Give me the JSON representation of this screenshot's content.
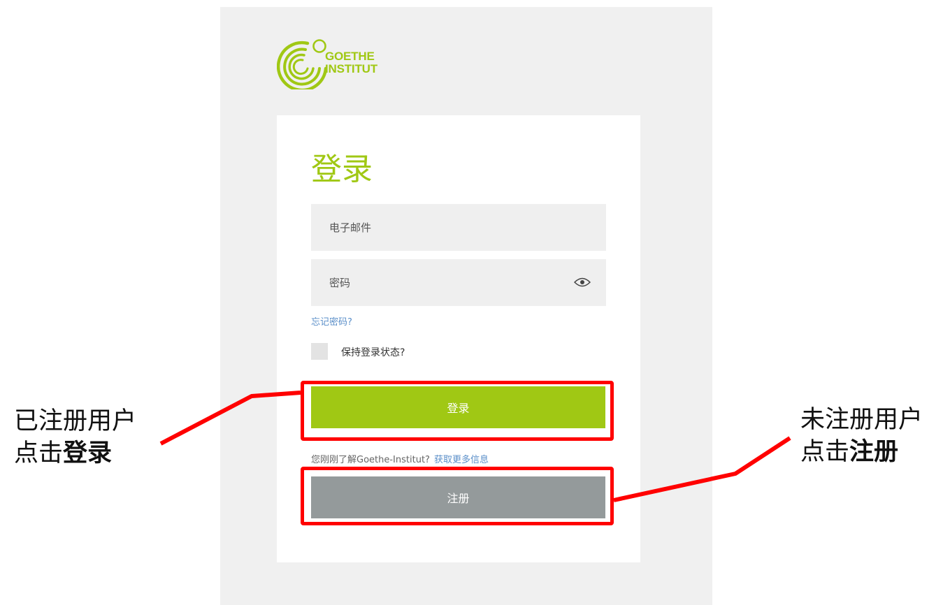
{
  "logo": {
    "line1": "GOETHE",
    "line2": "INSTITUT"
  },
  "login_form": {
    "title": "登录",
    "email_placeholder": "电子邮件",
    "password_placeholder": "密码",
    "show_password_icon": "eye-icon",
    "forgot_password_link": "忘记密码?",
    "remember_me_label": "保持登录状态?",
    "login_button": "登录",
    "info_text": "您刚刚了解Goethe-Institut?",
    "info_link": "获取更多信息",
    "register_button": "注册"
  },
  "annotations": {
    "left": {
      "line1": "已注册用户",
      "line2_prefix": "点击",
      "line2_bold": "登录"
    },
    "right": {
      "line1": "未注册用户",
      "line2_prefix": "点击",
      "line2_bold": "注册"
    }
  },
  "colors": {
    "brand_green": "#a0c814",
    "link_blue": "#5b8fc9",
    "register_gray": "#949a9b",
    "highlight_red": "#ff0000",
    "panel_bg": "#f0f0f0"
  }
}
